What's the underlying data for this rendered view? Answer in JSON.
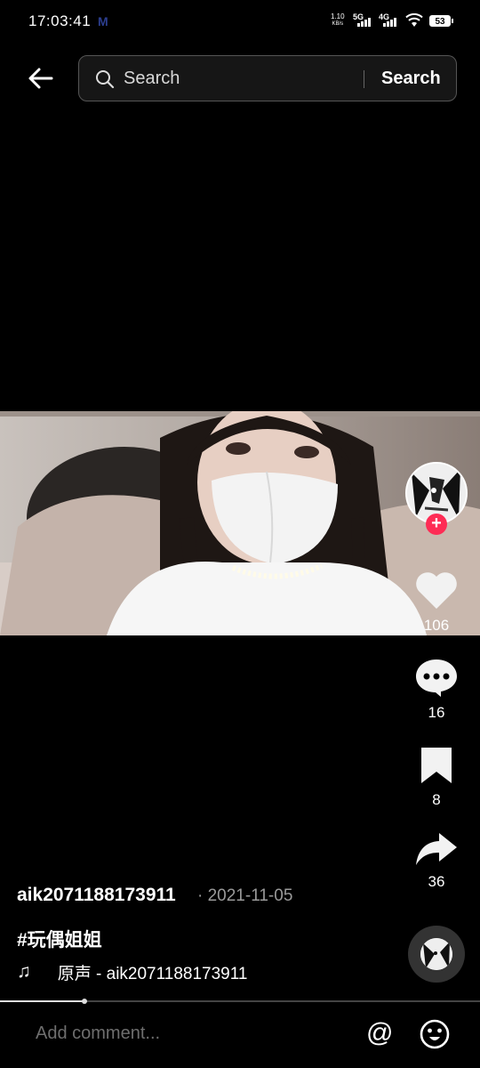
{
  "status_bar": {
    "time": "17:03:41",
    "carrier_icon": "M",
    "net_speed": "1.10",
    "net_unit": "KB/s",
    "sim1": "5G",
    "sim2": "4G",
    "battery": "53"
  },
  "header": {
    "search_placeholder": "Search",
    "search_button": "Search"
  },
  "post": {
    "author": "aik2071188173911",
    "date": "· 2021-11-05",
    "hashtag": "#玩偶姐姐",
    "music": "原声 - aik2071188173911",
    "progress_fraction": 0.175
  },
  "actions": {
    "likes": "106",
    "comments": "16",
    "saves": "8",
    "shares": "36"
  },
  "comment_bar": {
    "placeholder": "Add comment...",
    "mention": "@"
  },
  "colors": {
    "accent": "#fe2c55",
    "background": "#000000"
  }
}
